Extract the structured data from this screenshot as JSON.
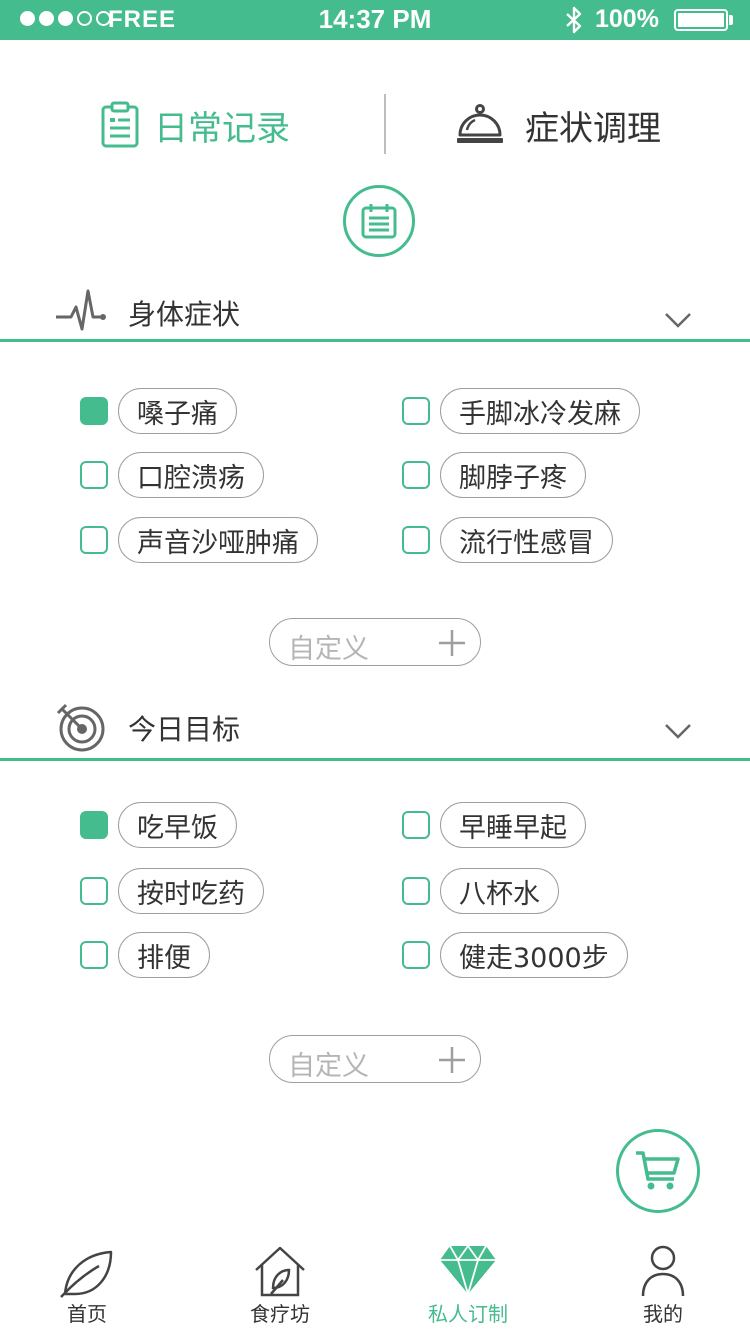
{
  "status_bar": {
    "carrier": "FREE",
    "time": "14:37 PM",
    "battery": "100%"
  },
  "tabs": {
    "daily": "日常记录",
    "symptoms": "症状调理"
  },
  "icons": {
    "daily": "clipboard-icon",
    "symptoms": "cloche-icon",
    "calendar": "calendar-icon",
    "body": "heartbeat-icon",
    "goals": "target-icon",
    "cart": "cart-icon"
  },
  "colors": {
    "accent": "#45bc8e",
    "text": "#333333",
    "border": "#9e9e9e"
  },
  "body_symptoms": {
    "title": "身体症状",
    "items": [
      {
        "label": "嗓子痛",
        "checked": true
      },
      {
        "label": "手脚冰冷发麻",
        "checked": false
      },
      {
        "label": "口腔溃疡",
        "checked": false
      },
      {
        "label": "脚脖子疼",
        "checked": false
      },
      {
        "label": "声音沙哑肿痛",
        "checked": false
      },
      {
        "label": "流行性感冒",
        "checked": false
      }
    ],
    "custom_label": "自定义"
  },
  "today_goals": {
    "title": "今日目标",
    "items": [
      {
        "label": "吃早饭",
        "checked": true
      },
      {
        "label": "早睡早起",
        "checked": false
      },
      {
        "label": "按时吃药",
        "checked": false
      },
      {
        "label": "八杯水",
        "checked": false
      },
      {
        "label": "排便",
        "checked": false
      },
      {
        "label": "健走3000步",
        "checked": false
      }
    ],
    "custom_label": "自定义"
  },
  "bottom_nav": {
    "items": [
      {
        "label": "首页",
        "icon": "leaf-icon",
        "active": false
      },
      {
        "label": "食疗坊",
        "icon": "house-icon",
        "active": false
      },
      {
        "label": "私人订制",
        "icon": "diamond-icon",
        "active": true
      },
      {
        "label": "我的",
        "icon": "person-icon",
        "active": false
      }
    ]
  }
}
